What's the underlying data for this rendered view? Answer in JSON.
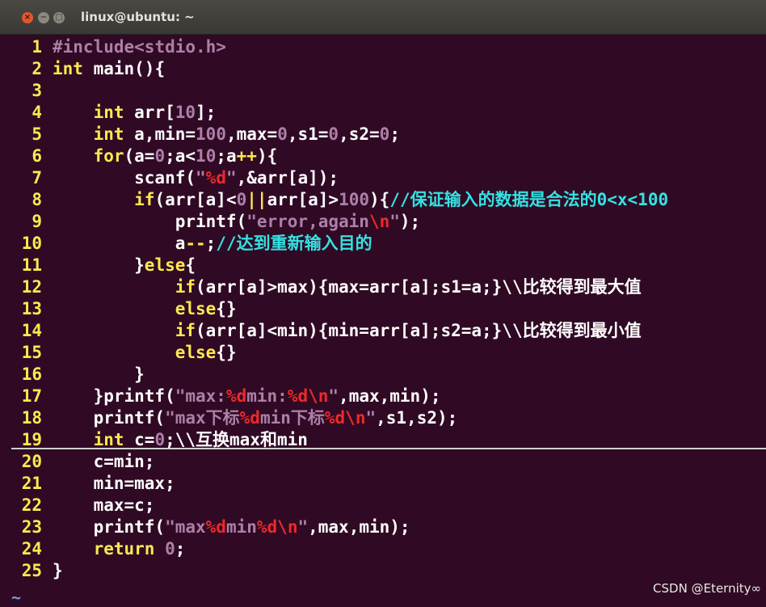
{
  "window": {
    "title": "linux@ubuntu: ~",
    "buttons": {
      "close": "×",
      "minimize": "−",
      "maximize": "□"
    }
  },
  "editor": {
    "tilde": "~",
    "lines": [
      {
        "n": "1",
        "segs": [
          [
            "pp",
            "#include"
          ],
          [
            "hd",
            "<stdio.h>"
          ]
        ]
      },
      {
        "n": "2",
        "segs": [
          [
            "kw",
            "int"
          ],
          [
            "tx",
            " main(){"
          ]
        ]
      },
      {
        "n": "3",
        "segs": []
      },
      {
        "n": "4",
        "segs": [
          [
            "tx",
            "    "
          ],
          [
            "kw",
            "int"
          ],
          [
            "tx",
            " arr["
          ],
          [
            "num",
            "10"
          ],
          [
            "tx",
            "];"
          ]
        ]
      },
      {
        "n": "5",
        "segs": [
          [
            "tx",
            "    "
          ],
          [
            "kw",
            "int"
          ],
          [
            "tx",
            " a,min="
          ],
          [
            "num",
            "100"
          ],
          [
            "tx",
            ",max="
          ],
          [
            "num",
            "0"
          ],
          [
            "tx",
            ",s1="
          ],
          [
            "num",
            "0"
          ],
          [
            "tx",
            ",s2="
          ],
          [
            "num",
            "0"
          ],
          [
            "tx",
            ";"
          ]
        ]
      },
      {
        "n": "6",
        "segs": [
          [
            "tx",
            "    "
          ],
          [
            "kw",
            "for"
          ],
          [
            "tx",
            "(a="
          ],
          [
            "num",
            "0"
          ],
          [
            "tx",
            ";a<"
          ],
          [
            "num",
            "10"
          ],
          [
            "tx",
            ";a"
          ],
          [
            "op",
            "++"
          ],
          [
            "tx",
            "){"
          ]
        ]
      },
      {
        "n": "7",
        "segs": [
          [
            "tx",
            "        scanf("
          ],
          [
            "str",
            "\""
          ],
          [
            "esc",
            "%d"
          ],
          [
            "str",
            "\""
          ],
          [
            "tx",
            ",&arr[a]);"
          ]
        ]
      },
      {
        "n": "8",
        "segs": [
          [
            "tx",
            "        "
          ],
          [
            "kw",
            "if"
          ],
          [
            "tx",
            "(arr[a]<"
          ],
          [
            "num",
            "0"
          ],
          [
            "op",
            "||"
          ],
          [
            "tx",
            "arr[a]>"
          ],
          [
            "num",
            "100"
          ],
          [
            "tx",
            "){"
          ],
          [
            "cm",
            "//保证输入的数据是合法的0<x<100"
          ]
        ]
      },
      {
        "n": "9",
        "segs": [
          [
            "tx",
            "            printf("
          ],
          [
            "str",
            "\"error,again"
          ],
          [
            "esc",
            "\\n"
          ],
          [
            "str",
            "\""
          ],
          [
            "tx",
            ");"
          ]
        ]
      },
      {
        "n": "10",
        "segs": [
          [
            "tx",
            "            a"
          ],
          [
            "op",
            "--"
          ],
          [
            "tx",
            ";"
          ],
          [
            "cm",
            "//达到重新输入目的"
          ]
        ]
      },
      {
        "n": "11",
        "segs": [
          [
            "tx",
            "        }"
          ],
          [
            "kw",
            "else"
          ],
          [
            "tx",
            "{"
          ]
        ]
      },
      {
        "n": "12",
        "segs": [
          [
            "tx",
            "            "
          ],
          [
            "kw",
            "if"
          ],
          [
            "tx",
            "(arr[a]>max){max=arr[a];s1=a;}\\\\比较得到最大值"
          ]
        ]
      },
      {
        "n": "13",
        "segs": [
          [
            "tx",
            "            "
          ],
          [
            "kw",
            "else"
          ],
          [
            "tx",
            "{}"
          ]
        ]
      },
      {
        "n": "14",
        "segs": [
          [
            "tx",
            "            "
          ],
          [
            "kw",
            "if"
          ],
          [
            "tx",
            "(arr[a]<min){min=arr[a];s2=a;}\\\\比较得到最小值"
          ]
        ]
      },
      {
        "n": "15",
        "segs": [
          [
            "tx",
            "            "
          ],
          [
            "kw",
            "else"
          ],
          [
            "tx",
            "{}"
          ]
        ]
      },
      {
        "n": "16",
        "segs": [
          [
            "tx",
            "        }"
          ]
        ]
      },
      {
        "n": "17",
        "segs": [
          [
            "tx",
            "    }printf("
          ],
          [
            "str",
            "\"max:"
          ],
          [
            "esc",
            "%d"
          ],
          [
            "str",
            "min:"
          ],
          [
            "esc",
            "%d\\n"
          ],
          [
            "str",
            "\""
          ],
          [
            "tx",
            ",max,min);"
          ]
        ]
      },
      {
        "n": "18",
        "segs": [
          [
            "tx",
            "    printf("
          ],
          [
            "str",
            "\"max下标"
          ],
          [
            "esc",
            "%d"
          ],
          [
            "str",
            "min下标"
          ],
          [
            "esc",
            "%d\\n"
          ],
          [
            "str",
            "\""
          ],
          [
            "tx",
            ",s1,s2);"
          ]
        ]
      },
      {
        "n": "19",
        "segs": [
          [
            "tx",
            "    "
          ],
          [
            "kw",
            "int"
          ],
          [
            "tx",
            " c="
          ],
          [
            "num",
            "0"
          ],
          [
            "tx",
            ";\\\\互换max和min"
          ]
        ]
      },
      {
        "n": "20",
        "segs": [
          [
            "tx",
            "    c=min;"
          ]
        ]
      },
      {
        "n": "21",
        "segs": [
          [
            "tx",
            "    min=max;"
          ]
        ]
      },
      {
        "n": "22",
        "segs": [
          [
            "tx",
            "    max=c;"
          ]
        ]
      },
      {
        "n": "23",
        "segs": [
          [
            "tx",
            "    printf("
          ],
          [
            "str",
            "\"max"
          ],
          [
            "esc",
            "%d"
          ],
          [
            "str",
            "min"
          ],
          [
            "esc",
            "%d\\n"
          ],
          [
            "str",
            "\""
          ],
          [
            "tx",
            ",max,min);"
          ]
        ]
      },
      {
        "n": "24",
        "segs": [
          [
            "tx",
            "    "
          ],
          [
            "kw",
            "return"
          ],
          [
            "tx",
            " "
          ],
          [
            "num",
            "0"
          ],
          [
            "tx",
            ";"
          ]
        ]
      },
      {
        "n": "25",
        "segs": [
          [
            "tx",
            "}"
          ]
        ]
      }
    ]
  },
  "watermark": "CSDN @Eternity∞",
  "colors": {
    "background": "#300a24",
    "keyword": "#fce94f",
    "preprocessor": "#ad7fa8",
    "number": "#ad7fa8",
    "escape": "#ef2929",
    "comment": "#34e2e2"
  }
}
